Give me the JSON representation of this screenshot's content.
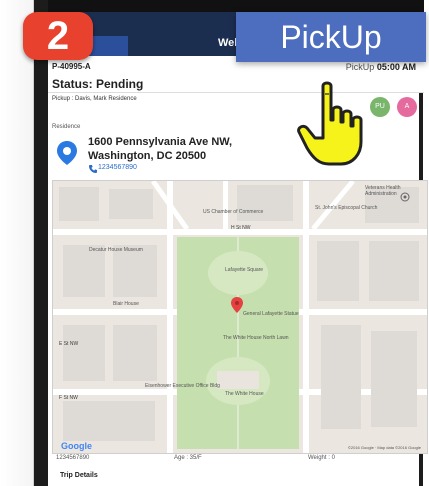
{
  "app": {
    "title": "WellRy"
  },
  "step": {
    "number": "2"
  },
  "banner": {
    "label": "PickUp"
  },
  "header": {
    "trip_id": "P-40995-A",
    "status": "Status: Pending",
    "pickup_label": "PickUp",
    "pickup_time": "05:00 AM"
  },
  "pickup": {
    "text": "Pickup : Davis, Mark Residence"
  },
  "badges": {
    "pu": "PU",
    "a": "A"
  },
  "residence": {
    "label": "Residence",
    "address_line1": "1600 Pennsylvania Ave NW,",
    "address_line2": "Washington, DC 20500",
    "phone": "1234567890"
  },
  "map": {
    "labels": {
      "veterans": "Veterans Health Administration",
      "us_chamber": "US Chamber of Commerce",
      "st_johns": "St. John's Episcopal Church",
      "h_st": "H St NW",
      "decatur": "Decatur House Museum",
      "lafayette_sq": "Lafayette Square",
      "blair": "Blair House",
      "statue": "General Lafayette Statue",
      "white_house_north": "The White House North Lawn",
      "e_st": "E St NW",
      "eisenhower": "Eisenhower Executive Office Bldg",
      "white_house": "The White House",
      "f_st": "F St NW",
      "google": "Google",
      "terms": "©2016 Google · Map data ©2016 Google"
    }
  },
  "footer": {
    "phone": "1234567890",
    "age": "Age : 35/F",
    "weight": "Weight : 0"
  },
  "trip_details": {
    "label": "Trip Details"
  },
  "colors": {
    "accent_red": "#e8412e",
    "banner_blue": "#4d6dbe",
    "pu_green": "#79b56a",
    "a_pink": "#e56a9d",
    "link_blue": "#2a6cc7",
    "hand_yellow": "#f6f31b"
  },
  "icons": {
    "location": "map-pin-icon",
    "phone": "phone-icon",
    "pointer": "hand-pointer-icon"
  }
}
